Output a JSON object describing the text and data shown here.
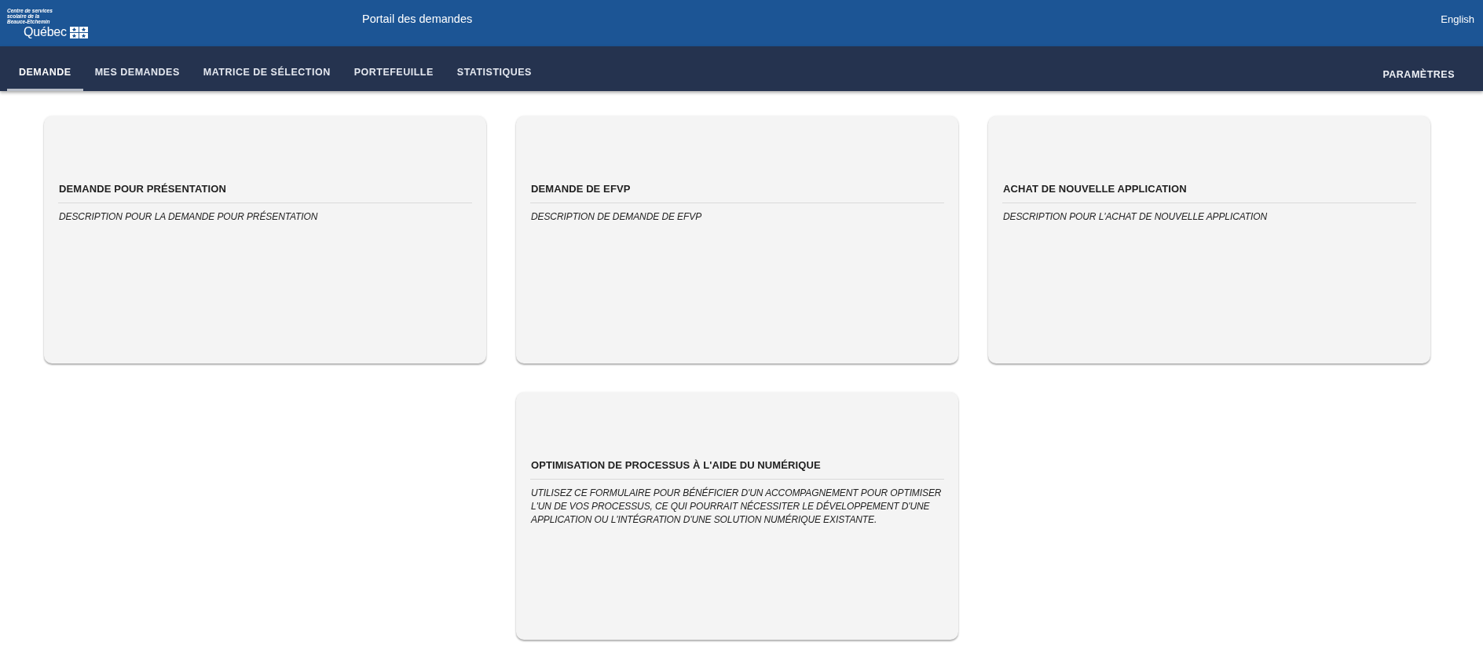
{
  "header": {
    "organization": [
      "Centre de services",
      "scolaire de la",
      "Beauce-Etchemin"
    ],
    "wordmark": "Québec",
    "title": "Portail des demandes",
    "language_link": "English"
  },
  "nav": {
    "tabs": [
      {
        "label": "DEMANDE",
        "selected": true
      },
      {
        "label": "MES DEMANDES",
        "selected": false
      },
      {
        "label": "MATRICE DE SÉLECTION",
        "selected": false
      },
      {
        "label": "PORTEFEUILLE",
        "selected": false
      },
      {
        "label": "STATISTIQUES",
        "selected": false
      }
    ],
    "settings_link": "PARAMÈTRES"
  },
  "cards": [
    {
      "title": "DEMANDE POUR PRÉSENTATION",
      "description": "DESCRIPTION POUR LA DEMANDE POUR PRÉSENTATION"
    },
    {
      "title": "DEMANDE DE EFVP",
      "description": "DESCRIPTION DE DEMANDE DE EFVP"
    },
    {
      "title": "ACHAT DE NOUVELLE APPLICATION",
      "description": "DESCRIPTION POUR L'ACHAT DE NOUVELLE APPLICATION"
    },
    {
      "title": "OPTIMISATION DE PROCESSUS À L'AIDE DU NUMÉRIQUE",
      "description": "UTILISEZ CE FORMULAIRE POUR BÉNÉFICIER D'UN ACCOMPAGNEMENT POUR OPTIMISER L'UN DE VOS PROCESSUS, CE QUI POURRAIT NÉCESSITER LE DÉVELOPPEMENT D'UNE APPLICATION OU L'INTÉGRATION D'UNE SOLUTION NUMÉRIQUE EXISTANTE."
    }
  ]
}
